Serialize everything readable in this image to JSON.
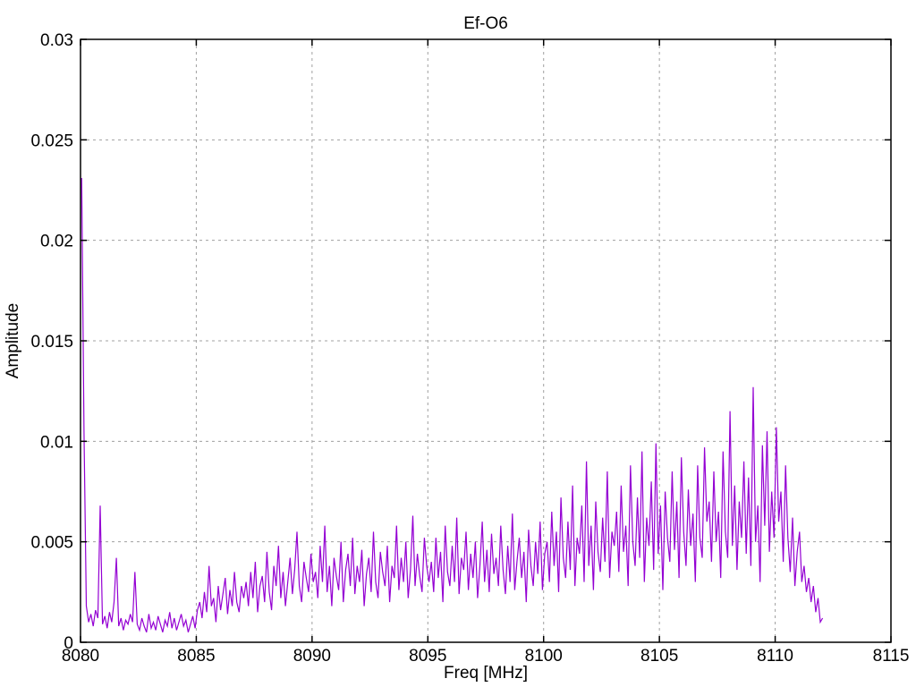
{
  "window": {
    "background": "#ffffff"
  },
  "chart_data": {
    "type": "line",
    "title": "Ef-O6",
    "xlabel": "Freq [MHz]",
    "ylabel": "Amplitude",
    "xlim": [
      8080,
      8115
    ],
    "ylim": [
      0,
      0.03
    ],
    "x_ticks": [
      8080,
      8085,
      8090,
      8095,
      8100,
      8105,
      8110,
      8115
    ],
    "x_tick_labels": [
      "8080",
      "8085",
      "8090",
      "8095",
      "8100",
      "8105",
      "8110",
      "8115"
    ],
    "y_ticks": [
      0,
      0.005,
      0.01,
      0.015,
      0.02,
      0.025,
      0.03
    ],
    "y_tick_labels": [
      "0",
      "0.005",
      "0.01",
      "0.015",
      "0.02",
      "0.025",
      "0.03"
    ],
    "grid": true,
    "legend": "none",
    "line_color": "#9400d3",
    "grid_color": "#a0a0a0",
    "axis_color": "#000000",
    "series": [
      {
        "x_start": 8080.05,
        "x_step": 0.1,
        "y_scale": 0.0001,
        "y": [
          231,
          105,
          18,
          10,
          14,
          8,
          16,
          12,
          68,
          9,
          13,
          7,
          15,
          10,
          20,
          42,
          8,
          12,
          6,
          11,
          9,
          14,
          10,
          35,
          9,
          6,
          12,
          8,
          5,
          14,
          7,
          10,
          6,
          13,
          9,
          5,
          11,
          8,
          15,
          7,
          12,
          6,
          10,
          14,
          8,
          11,
          5,
          9,
          13,
          7,
          16,
          20,
          12,
          25,
          15,
          38,
          18,
          22,
          10,
          28,
          16,
          24,
          32,
          14,
          26,
          18,
          35,
          20,
          15,
          28,
          22,
          30,
          18,
          35,
          22,
          40,
          15,
          28,
          33,
          20,
          45,
          25,
          16,
          38,
          28,
          48,
          22,
          35,
          18,
          30,
          42,
          24,
          36,
          55,
          28,
          20,
          40,
          32,
          25,
          44,
          30,
          35,
          22,
          48,
          30,
          58,
          25,
          38,
          18,
          42,
          33,
          26,
          50,
          20,
          36,
          44,
          28,
          52,
          24,
          38,
          30,
          46,
          18,
          34,
          42,
          25,
          55,
          30,
          22,
          45,
          35,
          28,
          48,
          20,
          38,
          32,
          58,
          26,
          42,
          30,
          50,
          22,
          36,
          63,
          28,
          44,
          33,
          25,
          52,
          38,
          30,
          40,
          25,
          52,
          32,
          45,
          20,
          58,
          35,
          28,
          48,
          30,
          62,
          24,
          42,
          36,
          55,
          26,
          44,
          32,
          50,
          22,
          38,
          60,
          30,
          46,
          25,
          54,
          34,
          42,
          28,
          58,
          36,
          24,
          48,
          30,
          64,
          26,
          40,
          52,
          32,
          45,
          20,
          56,
          38,
          28,
          50,
          34,
          60,
          26,
          44,
          50,
          30,
          65,
          38,
          55,
          25,
          72,
          42,
          32,
          60,
          36,
          78,
          28,
          52,
          44,
          68,
          30,
          90,
          38,
          58,
          26,
          70,
          45,
          35,
          62,
          40,
          85,
          32,
          55,
          48,
          65,
          35,
          78,
          45,
          58,
          28,
          88,
          50,
          38,
          72,
          42,
          95,
          30,
          62,
          48,
          80,
          36,
          99,
          44,
          68,
          26,
          75,
          52,
          40,
          85,
          46,
          70,
          32,
          92,
          55,
          38,
          76,
          48,
          64,
          30,
          88,
          52,
          42,
          97,
          60,
          70,
          40,
          85,
          50,
          65,
          32,
          95,
          55,
          42,
          115,
          48,
          78,
          36,
          70,
          52,
          90,
          44,
          82,
          38,
          127,
          50,
          68,
          30,
          98,
          58,
          105,
          45,
          75,
          52,
          107,
          60,
          75,
          40,
          88,
          52,
          35,
          62,
          28,
          45,
          55,
          30,
          38,
          25,
          32,
          20,
          28,
          15,
          22,
          10,
          12
        ]
      }
    ]
  }
}
